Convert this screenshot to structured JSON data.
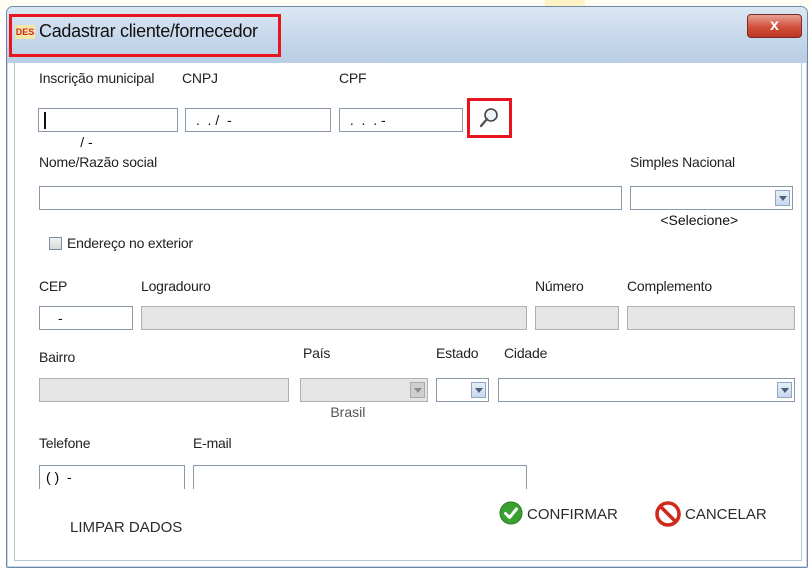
{
  "window": {
    "title": "Cadastrar cliente/fornecedor",
    "icon_text": "DES",
    "close_label": "x"
  },
  "form": {
    "inscricao_label": "Inscrição municipal",
    "inscricao_value": " / -",
    "cnpj_label": "CNPJ",
    "cnpj_value": " .  . /  -",
    "cpf_label": "CPF",
    "cpf_value": " .  .  . -",
    "nome_label": "Nome/Razão social",
    "nome_value": "",
    "simples_label": "Simples Nacional",
    "simples_value": "<Selecione>",
    "exterior_label": "Endereço no exterior",
    "exterior_checked": false,
    "cep_label": "CEP",
    "cep_value": "-",
    "logradouro_label": "Logradouro",
    "numero_label": "Número",
    "complemento_label": "Complemento",
    "bairro_label": "Bairro",
    "pais_label": "País",
    "pais_value": "Brasil",
    "estado_label": "Estado",
    "cidade_label": "Cidade",
    "telefone_label": "Telefone",
    "telefone_value": "( )  -",
    "email_label": "E-mail"
  },
  "actions": {
    "clear_label": "LIMPAR DADOS",
    "confirm_label": "CONFIRMAR",
    "cancel_label": "CANCELAR"
  },
  "icons": {
    "search": "search-icon",
    "confirm": "check-circle-icon",
    "cancel": "no-entry-icon"
  },
  "colors": {
    "highlight": "#e8151f",
    "confirm_green": "#3aa030",
    "cancel_red": "#d02a1c"
  }
}
